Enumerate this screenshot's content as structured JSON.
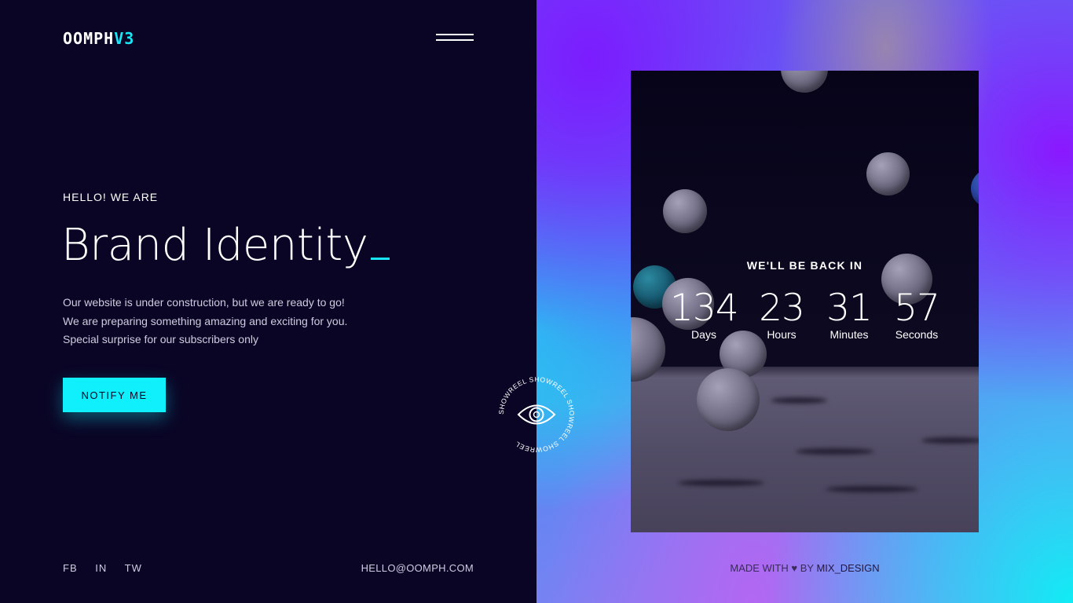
{
  "brand": {
    "logo_main": "OOMPH",
    "logo_accent": "V3"
  },
  "hero": {
    "eyebrow": "HELLO! WE ARE",
    "headline": "Brand Identity",
    "description": [
      "Our website is under construction, but we are ready to go!",
      "We are preparing something amazing and exciting for you.",
      "Special surprise for our subscribers only"
    ],
    "notify_label": "NOTIFY ME"
  },
  "footer": {
    "socials": [
      "FB",
      "IN",
      "TW"
    ],
    "email": "HELLO@OOMPH.COM",
    "credit_prefix": "MADE WITH",
    "credit_by": "BY",
    "credit_brand": "MIX_DESIGN"
  },
  "countdown": {
    "label": "WE'LL BE BACK IN",
    "units": [
      {
        "value": "134",
        "label": "Days"
      },
      {
        "value": "23",
        "label": "Hours"
      },
      {
        "value": "31",
        "label": "Minutes"
      },
      {
        "value": "57",
        "label": "Seconds"
      }
    ]
  },
  "showreel": {
    "ring_text": "SHOWREEL SHOWREEL SHOWREEL SHOWREEL "
  },
  "icons": {
    "menu": "hamburger-icon",
    "heart": "heart-icon",
    "eye": "eye-icon"
  },
  "colors": {
    "background": "#0a0525",
    "accent": "#0ff0fc",
    "gradient_purple": "#7b1cff",
    "gradient_cyan": "#10ecf5"
  }
}
